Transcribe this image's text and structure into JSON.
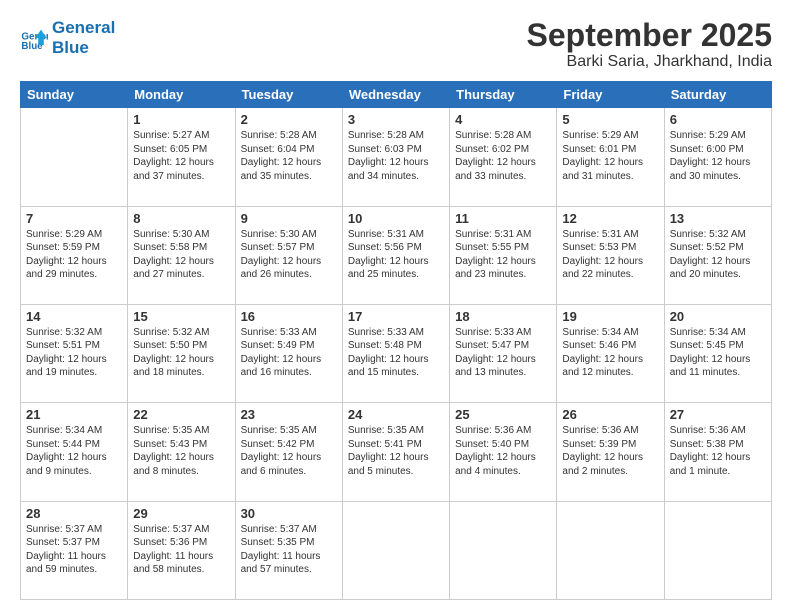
{
  "header": {
    "logo_line1": "General",
    "logo_line2": "Blue",
    "title": "September 2025",
    "subtitle": "Barki Saria, Jharkhand, India"
  },
  "days_of_week": [
    "Sunday",
    "Monday",
    "Tuesday",
    "Wednesday",
    "Thursday",
    "Friday",
    "Saturday"
  ],
  "weeks": [
    [
      {
        "num": "",
        "info": ""
      },
      {
        "num": "1",
        "info": "Sunrise: 5:27 AM\nSunset: 6:05 PM\nDaylight: 12 hours\nand 37 minutes."
      },
      {
        "num": "2",
        "info": "Sunrise: 5:28 AM\nSunset: 6:04 PM\nDaylight: 12 hours\nand 35 minutes."
      },
      {
        "num": "3",
        "info": "Sunrise: 5:28 AM\nSunset: 6:03 PM\nDaylight: 12 hours\nand 34 minutes."
      },
      {
        "num": "4",
        "info": "Sunrise: 5:28 AM\nSunset: 6:02 PM\nDaylight: 12 hours\nand 33 minutes."
      },
      {
        "num": "5",
        "info": "Sunrise: 5:29 AM\nSunset: 6:01 PM\nDaylight: 12 hours\nand 31 minutes."
      },
      {
        "num": "6",
        "info": "Sunrise: 5:29 AM\nSunset: 6:00 PM\nDaylight: 12 hours\nand 30 minutes."
      }
    ],
    [
      {
        "num": "7",
        "info": "Sunrise: 5:29 AM\nSunset: 5:59 PM\nDaylight: 12 hours\nand 29 minutes."
      },
      {
        "num": "8",
        "info": "Sunrise: 5:30 AM\nSunset: 5:58 PM\nDaylight: 12 hours\nand 27 minutes."
      },
      {
        "num": "9",
        "info": "Sunrise: 5:30 AM\nSunset: 5:57 PM\nDaylight: 12 hours\nand 26 minutes."
      },
      {
        "num": "10",
        "info": "Sunrise: 5:31 AM\nSunset: 5:56 PM\nDaylight: 12 hours\nand 25 minutes."
      },
      {
        "num": "11",
        "info": "Sunrise: 5:31 AM\nSunset: 5:55 PM\nDaylight: 12 hours\nand 23 minutes."
      },
      {
        "num": "12",
        "info": "Sunrise: 5:31 AM\nSunset: 5:53 PM\nDaylight: 12 hours\nand 22 minutes."
      },
      {
        "num": "13",
        "info": "Sunrise: 5:32 AM\nSunset: 5:52 PM\nDaylight: 12 hours\nand 20 minutes."
      }
    ],
    [
      {
        "num": "14",
        "info": "Sunrise: 5:32 AM\nSunset: 5:51 PM\nDaylight: 12 hours\nand 19 minutes."
      },
      {
        "num": "15",
        "info": "Sunrise: 5:32 AM\nSunset: 5:50 PM\nDaylight: 12 hours\nand 18 minutes."
      },
      {
        "num": "16",
        "info": "Sunrise: 5:33 AM\nSunset: 5:49 PM\nDaylight: 12 hours\nand 16 minutes."
      },
      {
        "num": "17",
        "info": "Sunrise: 5:33 AM\nSunset: 5:48 PM\nDaylight: 12 hours\nand 15 minutes."
      },
      {
        "num": "18",
        "info": "Sunrise: 5:33 AM\nSunset: 5:47 PM\nDaylight: 12 hours\nand 13 minutes."
      },
      {
        "num": "19",
        "info": "Sunrise: 5:34 AM\nSunset: 5:46 PM\nDaylight: 12 hours\nand 12 minutes."
      },
      {
        "num": "20",
        "info": "Sunrise: 5:34 AM\nSunset: 5:45 PM\nDaylight: 12 hours\nand 11 minutes."
      }
    ],
    [
      {
        "num": "21",
        "info": "Sunrise: 5:34 AM\nSunset: 5:44 PM\nDaylight: 12 hours\nand 9 minutes."
      },
      {
        "num": "22",
        "info": "Sunrise: 5:35 AM\nSunset: 5:43 PM\nDaylight: 12 hours\nand 8 minutes."
      },
      {
        "num": "23",
        "info": "Sunrise: 5:35 AM\nSunset: 5:42 PM\nDaylight: 12 hours\nand 6 minutes."
      },
      {
        "num": "24",
        "info": "Sunrise: 5:35 AM\nSunset: 5:41 PM\nDaylight: 12 hours\nand 5 minutes."
      },
      {
        "num": "25",
        "info": "Sunrise: 5:36 AM\nSunset: 5:40 PM\nDaylight: 12 hours\nand 4 minutes."
      },
      {
        "num": "26",
        "info": "Sunrise: 5:36 AM\nSunset: 5:39 PM\nDaylight: 12 hours\nand 2 minutes."
      },
      {
        "num": "27",
        "info": "Sunrise: 5:36 AM\nSunset: 5:38 PM\nDaylight: 12 hours\nand 1 minute."
      }
    ],
    [
      {
        "num": "28",
        "info": "Sunrise: 5:37 AM\nSunset: 5:37 PM\nDaylight: 11 hours\nand 59 minutes."
      },
      {
        "num": "29",
        "info": "Sunrise: 5:37 AM\nSunset: 5:36 PM\nDaylight: 11 hours\nand 58 minutes."
      },
      {
        "num": "30",
        "info": "Sunrise: 5:37 AM\nSunset: 5:35 PM\nDaylight: 11 hours\nand 57 minutes."
      },
      {
        "num": "",
        "info": ""
      },
      {
        "num": "",
        "info": ""
      },
      {
        "num": "",
        "info": ""
      },
      {
        "num": "",
        "info": ""
      }
    ]
  ]
}
